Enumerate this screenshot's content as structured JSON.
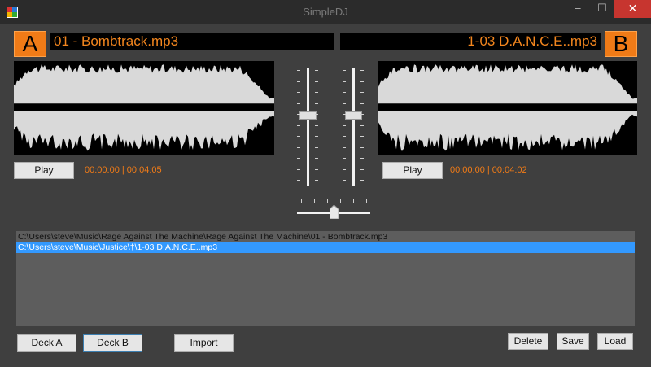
{
  "window": {
    "title": "SimpleDJ",
    "min_glyph": "–",
    "max_glyph": "☐",
    "close_glyph": "✕"
  },
  "deck_a": {
    "letter": "A",
    "track": "01 - Bombtrack.mp3",
    "play_label": "Play",
    "time": "00:00:00 | 00:04:05",
    "volume_fraction": 0.6
  },
  "deck_b": {
    "letter": "B",
    "track": "1-03 D.A.N.C.E..mp3",
    "play_label": "Play",
    "time": "00:00:00 | 00:04:02",
    "volume_fraction": 0.6
  },
  "crossfader": {
    "position_fraction": 0.5
  },
  "playlist": {
    "items": [
      "C:\\Users\\steve\\Music\\Rage Against The Machine\\Rage Against The Machine\\01 - Bombtrack.mp3",
      "C:\\Users\\steve\\Music\\Justice\\†\\1-03 D.A.N.C.E..mp3"
    ],
    "selected_index": 1
  },
  "buttons": {
    "deck_a": "Deck A",
    "deck_b": "Deck B",
    "import": "Import",
    "delete": "Delete",
    "save": "Save",
    "load": "Load"
  },
  "colors": {
    "accent": "#f07b17",
    "selection": "#3399ff",
    "close": "#c7352f",
    "waveform": "#d9d9d9"
  }
}
